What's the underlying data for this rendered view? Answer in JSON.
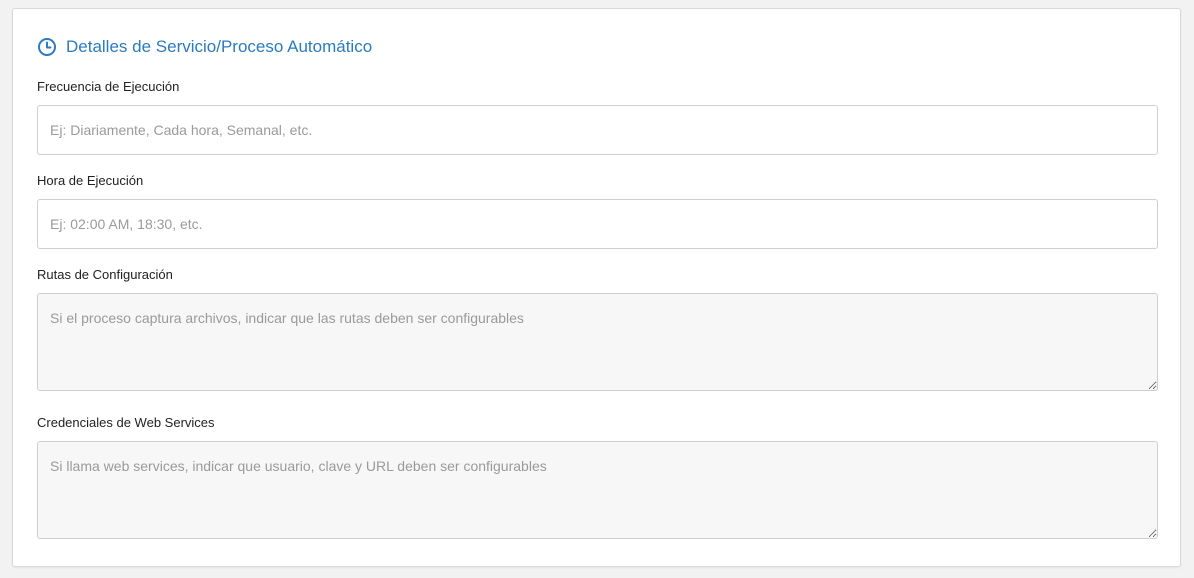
{
  "section": {
    "title": "Detalles de Servicio/Proceso Automático",
    "icon": "clock-icon",
    "accent_color": "#2a7bbf"
  },
  "fields": {
    "frecuencia": {
      "label": "Frecuencia de Ejecución",
      "placeholder": "Ej: Diariamente, Cada hora, Semanal, etc.",
      "value": ""
    },
    "hora": {
      "label": "Hora de Ejecución",
      "placeholder": "Ej: 02:00 AM, 18:30, etc.",
      "value": ""
    },
    "rutas": {
      "label": "Rutas de Configuración",
      "placeholder": "Si el proceso captura archivos, indicar que las rutas deben ser configurables",
      "value": ""
    },
    "credenciales": {
      "label": "Credenciales de Web Services",
      "placeholder": "Si llama web services, indicar que usuario, clave y URL deben ser configurables",
      "value": ""
    }
  }
}
